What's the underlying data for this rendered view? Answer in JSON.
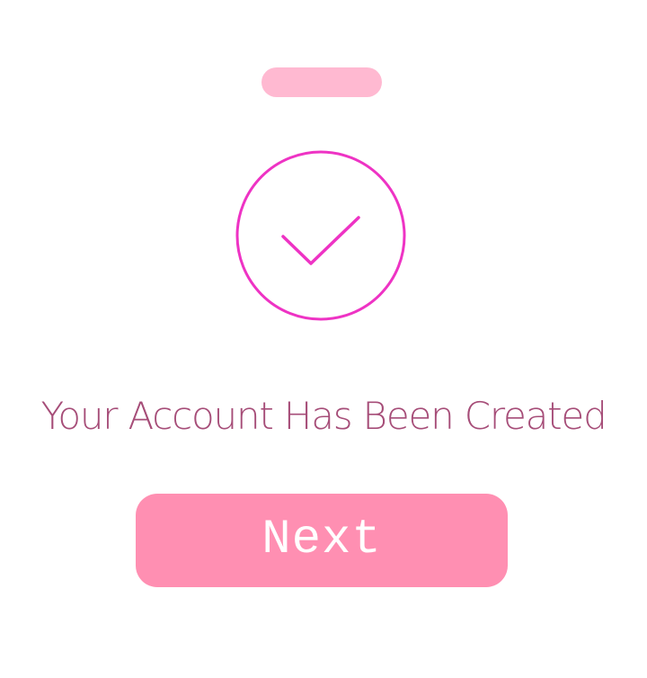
{
  "colors": {
    "background": "#ffffff",
    "handle": "#ffb9d1",
    "icon_stroke": "#ee33c4",
    "headline": "#a64d78",
    "button_bg": "#ff8fb2",
    "button_text": "#ffffff"
  },
  "icon": {
    "name": "checkmark-circle-icon"
  },
  "message": {
    "title": "Your Account Has Been Created"
  },
  "actions": {
    "next_label": "Next"
  }
}
